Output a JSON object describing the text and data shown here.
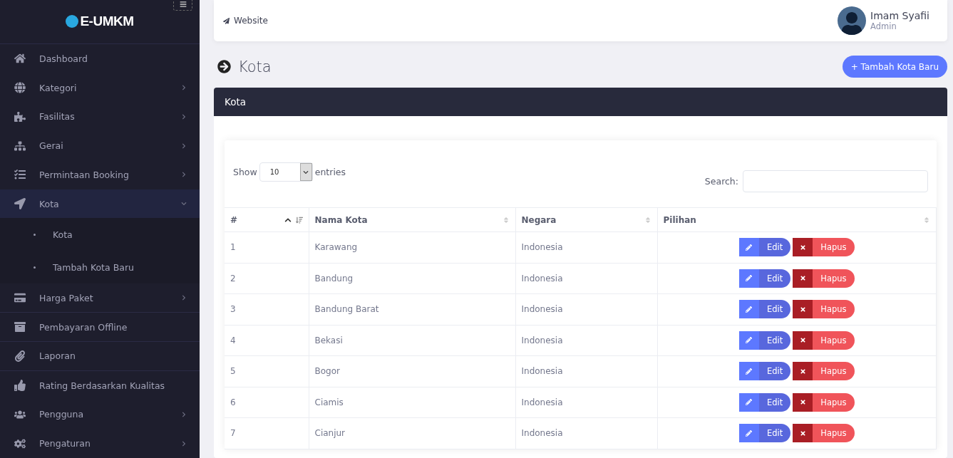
{
  "brand": {
    "name": "E-UMKM"
  },
  "sidebar": {
    "items": [
      {
        "label": "Dashboard",
        "selected": false
      },
      {
        "label": "Kategori",
        "selected": false,
        "expanded": false
      },
      {
        "label": "Fasilitas",
        "selected": false,
        "expanded": false
      },
      {
        "label": "Gerai",
        "selected": false,
        "expanded": false
      },
      {
        "label": "Permintaan Booking",
        "selected": false,
        "expanded": false
      },
      {
        "label": "Kota",
        "selected": true,
        "expanded": true,
        "children": [
          {
            "label": "Kota"
          },
          {
            "label": "Tambah Kota Baru"
          }
        ]
      },
      {
        "label": "Harga Paket",
        "selected": false,
        "expanded": false
      },
      {
        "label": "Pembayaran Offline",
        "selected": false
      },
      {
        "label": "Laporan",
        "selected": false
      },
      {
        "label": "Rating Berdasarkan Kualitas",
        "selected": false
      },
      {
        "label": "Pengguna",
        "selected": false,
        "expanded": false
      },
      {
        "label": "Pengaturan",
        "selected": false,
        "expanded": false
      }
    ]
  },
  "topbar": {
    "link": "Website",
    "user": {
      "name": "Imam Syafii",
      "role": "Admin"
    }
  },
  "page": {
    "title": "Kota",
    "add_button": "+ Tambah Kota Baru"
  },
  "card": {
    "title": "Kota",
    "show_label": "Show",
    "entries_value": "10",
    "entries_label": "entries",
    "search_label": "Search:"
  },
  "table": {
    "columns": [
      "#",
      "Nama Kota",
      "Negara",
      "Pilihan"
    ],
    "rows": [
      {
        "no": "1",
        "city": "Karawang",
        "country": "Indonesia",
        "edit": "Edit",
        "delete": "Hapus"
      },
      {
        "no": "2",
        "city": "Bandung",
        "country": "Indonesia",
        "edit": "Edit",
        "delete": "Hapus"
      },
      {
        "no": "3",
        "city": "Bandung Barat",
        "country": "Indonesia",
        "edit": "Edit",
        "delete": "Hapus"
      },
      {
        "no": "4",
        "city": "Bekasi",
        "country": "Indonesia",
        "edit": "Edit",
        "delete": "Hapus"
      },
      {
        "no": "5",
        "city": "Bogor",
        "country": "Indonesia",
        "edit": "Edit",
        "delete": "Hapus"
      },
      {
        "no": "6",
        "city": "Ciamis",
        "country": "Indonesia",
        "edit": "Edit",
        "delete": "Hapus"
      },
      {
        "no": "7",
        "city": "Cianjur",
        "country": "Indonesia",
        "edit": "Edit",
        "delete": "Hapus"
      }
    ]
  }
}
